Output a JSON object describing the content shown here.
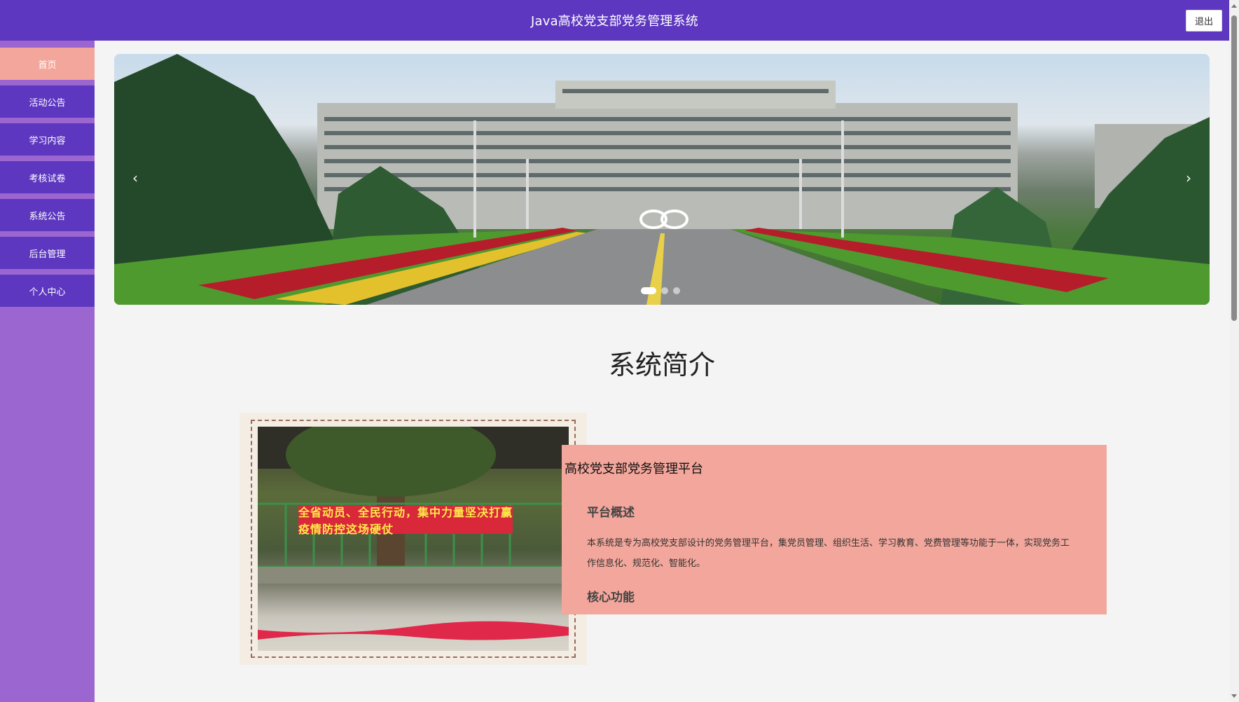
{
  "header": {
    "title": "Java高校党支部党务管理系统",
    "logout_label": "退出"
  },
  "sidebar": {
    "items": [
      {
        "label": "首页",
        "active": true
      },
      {
        "label": "活动公告"
      },
      {
        "label": "学习内容"
      },
      {
        "label": "考核试卷"
      },
      {
        "label": "系统公告"
      },
      {
        "label": "后台管理"
      },
      {
        "label": "个人中心"
      }
    ]
  },
  "carousel": {
    "prev_label": "‹",
    "next_label": "›",
    "slide_count": 3,
    "active_index": 0
  },
  "intro": {
    "section_title": "系统简介",
    "banner_text": "全省动员、全民行动，集中力量坚决打赢疫情防控这场硬仗",
    "card_title": "高校党支部党务管理平台",
    "overview_heading": "平台概述",
    "overview_text": "本系统是专为高校党支部设计的党务管理平台，集党员管理、组织生活、学习教育、党费管理等功能于一体，实现党务工作信息化、规范化、智能化。",
    "features_heading": "核心功能"
  },
  "colors": {
    "primary": "#5d37bf",
    "sidebar_bg": "#9b66d0",
    "accent": "#f3a69b"
  }
}
